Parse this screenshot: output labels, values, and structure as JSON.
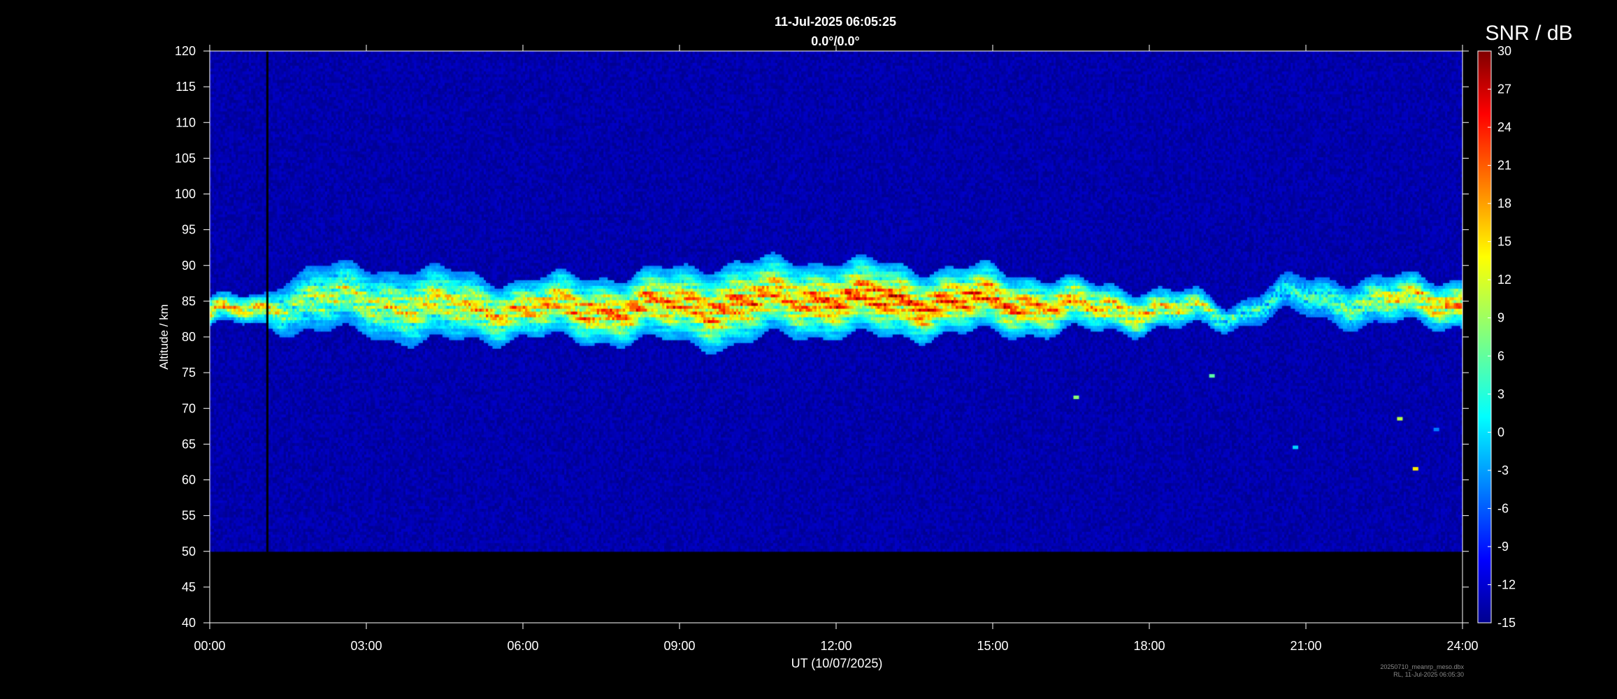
{
  "chart_data": {
    "type": "heatmap",
    "title": "11-Jul-2025 06:05:25",
    "subtitle": "0.0°/0.0°",
    "xlabel": "UT (10/07/2025)",
    "ylabel": "Altitude / km",
    "colorbar_label": "SNR / dB",
    "x_ticks": [
      "00:00",
      "03:00",
      "06:00",
      "09:00",
      "12:00",
      "15:00",
      "18:00",
      "21:00",
      "24:00"
    ],
    "x_range_hours": [
      0,
      24
    ],
    "y_ticks": [
      40,
      45,
      50,
      55,
      60,
      65,
      70,
      75,
      80,
      85,
      90,
      95,
      100,
      105,
      110,
      115,
      120
    ],
    "ylim": [
      40,
      120
    ],
    "data_altitude_range": [
      50,
      120
    ],
    "colorbar_ticks": [
      30,
      27,
      24,
      21,
      18,
      15,
      12,
      9,
      6,
      3,
      0,
      -3,
      -6,
      -9,
      -12,
      -15
    ],
    "clim": [
      -15,
      30
    ],
    "colormap": "jet",
    "background_snr": -13,
    "data_gap_hours": [
      1.08,
      1.14
    ],
    "echo_layer": {
      "time_hours": [
        0,
        1,
        1.5,
        2,
        3,
        4,
        5,
        6,
        7,
        8,
        9,
        10,
        11,
        12,
        13,
        14,
        15,
        16,
        17,
        18,
        19,
        19.5,
        20.5,
        21,
        22,
        23,
        24
      ],
      "center_km": [
        83.5,
        83.5,
        85,
        85.5,
        85,
        84.5,
        84,
        84,
        84,
        84,
        84.5,
        84.5,
        85.5,
        85.5,
        85,
        85,
        85,
        84.5,
        84,
        84,
        83.5,
        83,
        85.5,
        85.5,
        85,
        85,
        85
      ],
      "half_width_km": [
        1.5,
        1.5,
        3,
        3.5,
        3.5,
        4,
        3.5,
        3,
        3.5,
        3.5,
        4,
        4.5,
        4,
        4,
        4,
        3.5,
        3.5,
        3,
        2.5,
        2.2,
        1.8,
        1.2,
        1.8,
        2,
        2.5,
        2.5,
        2.5
      ],
      "peak_snr_db": [
        22,
        22,
        10,
        14,
        16,
        18,
        20,
        22,
        24,
        26,
        24,
        26,
        24,
        28,
        29,
        28,
        27,
        24,
        22,
        20,
        16,
        8,
        4,
        6,
        12,
        20,
        24
      ]
    },
    "isolated_echoes": [
      {
        "time_h": 16.6,
        "alt_km": 71.5,
        "snr_db": 8
      },
      {
        "time_h": 19.2,
        "alt_km": 74.5,
        "snr_db": 6
      },
      {
        "time_h": 22.8,
        "alt_km": 68.5,
        "snr_db": 10
      },
      {
        "time_h": 20.8,
        "alt_km": 64.5,
        "snr_db": 0
      },
      {
        "time_h": 23.1,
        "alt_km": 61.5,
        "snr_db": 14
      },
      {
        "time_h": 23.5,
        "alt_km": 67,
        "snr_db": -4
      }
    ],
    "grid": false,
    "colorbar_position": "right"
  },
  "footer": {
    "file_name": "20250710_meanrp_meso.dbx",
    "creator": "RL, 11-Jul-2025 06:05:30"
  }
}
